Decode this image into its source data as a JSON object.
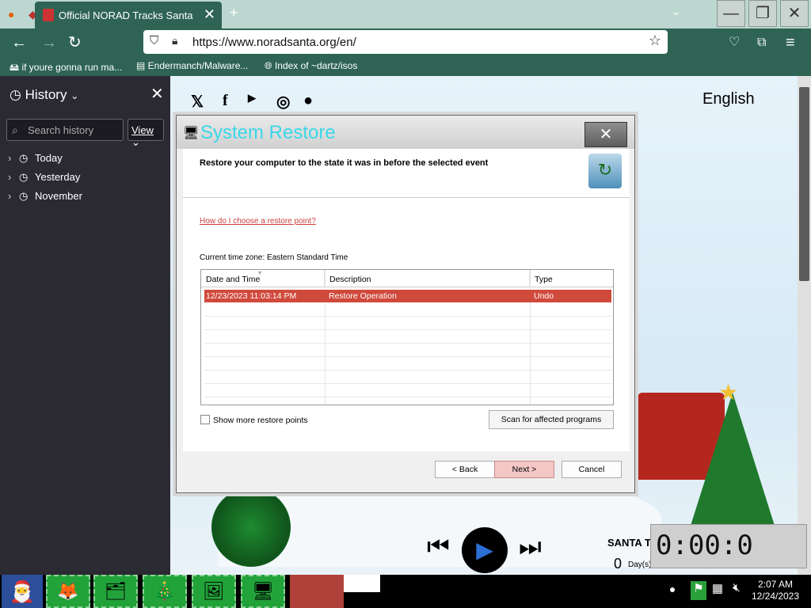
{
  "browser": {
    "tab": {
      "title": "Official NORAD Tracks Santa"
    },
    "url": "https://www.noradsanta.org/en/",
    "bookmarks": [
      "if youre gonna run ma...",
      "Endermanch/Malware...",
      "Index of ~dartz/isos"
    ]
  },
  "sidebar": {
    "title": "History",
    "search_placeholder": "Search history",
    "view_label": "View",
    "items": [
      {
        "label": "Today"
      },
      {
        "label": "Yesterday"
      },
      {
        "label": "November"
      }
    ]
  },
  "page": {
    "language": "English",
    "tracker_label": "SANTA T",
    "days_value": "0",
    "days_label": "Day(s)",
    "counter_text": "0:00:0"
  },
  "dialog": {
    "title": "System Restore",
    "heading": "Restore your computer to the state it was in before the selected event",
    "help_link": "How do I choose a restore point?",
    "timezone_label": "Current time zone: Eastern Standard Time",
    "columns": [
      "Date and Time",
      "Description",
      "Type"
    ],
    "rows": [
      {
        "date": "12/23/2023 11:03:14 PM",
        "description": "Restore Operation",
        "type": "Undo",
        "selected": true
      }
    ],
    "show_more_label": "Show more restore points",
    "scan_label": "Scan for affected programs",
    "back_label": "< Back",
    "next_label": "Next >",
    "cancel_label": "Cancel"
  },
  "taskbar": {
    "time": "2:07 AM",
    "date": "12/24/2023"
  }
}
